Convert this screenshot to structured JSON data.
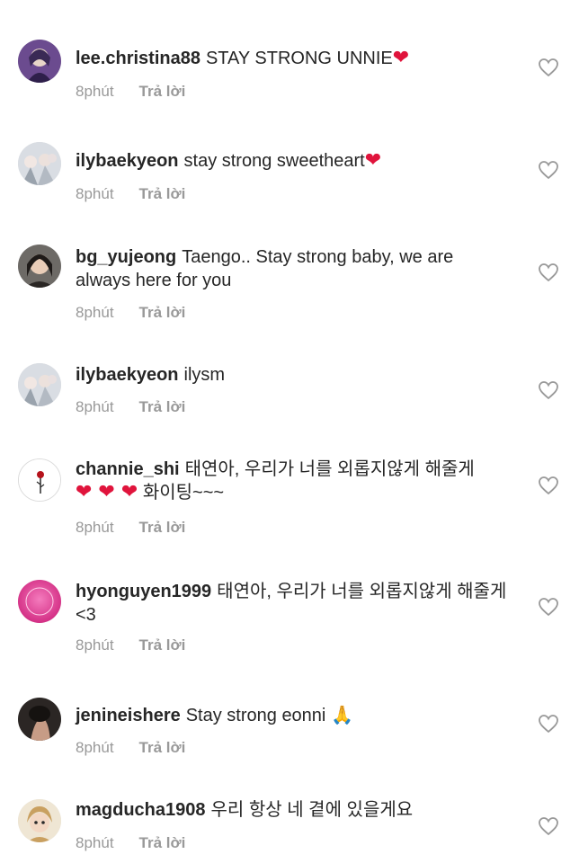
{
  "comments": [
    {
      "username": "lee.christina88",
      "text": "STAY STRONG UNNIE",
      "emoji": "❤",
      "time": "8phút",
      "reply": "Trả lời"
    },
    {
      "username": "ilybaekyeon",
      "text": "stay strong sweetheart",
      "emoji": "❤",
      "time": "8phút",
      "reply": "Trả lời"
    },
    {
      "username": "bg_yujeong",
      "text": "Taengo.. Stay strong baby, we are always here for you",
      "time": "8phút",
      "reply": "Trả lời"
    },
    {
      "username": "ilybaekyeon",
      "text": "ilysm",
      "time": "8phút",
      "reply": "Trả lời"
    },
    {
      "username": "channie_shi",
      "text": "태연아, 우리가 너를 외롭지않게 해줄게",
      "emoji": "❤ ❤ ❤",
      "text2": "화이팅~~~",
      "time": "8phút",
      "reply": "Trả lời"
    },
    {
      "username": "hyonguyen1999",
      "text": "태연아, 우리가 너를 외롭지않게 해줄게 <3",
      "time": "8phút",
      "reply": "Trả lời"
    },
    {
      "username": "jenineishere",
      "text": "Stay strong eonni",
      "emoji": "🙏",
      "time": "8phút",
      "reply": "Trả lời"
    },
    {
      "username": "magducha1908",
      "text": "우리 항상 네 곁에 있을게요",
      "time": "8phút",
      "reply": "Trả lời"
    }
  ],
  "icons": {
    "like": "heart-outline-icon"
  },
  "colors": {
    "text": "#262626",
    "meta": "#999999",
    "heart": "#e0143c"
  }
}
